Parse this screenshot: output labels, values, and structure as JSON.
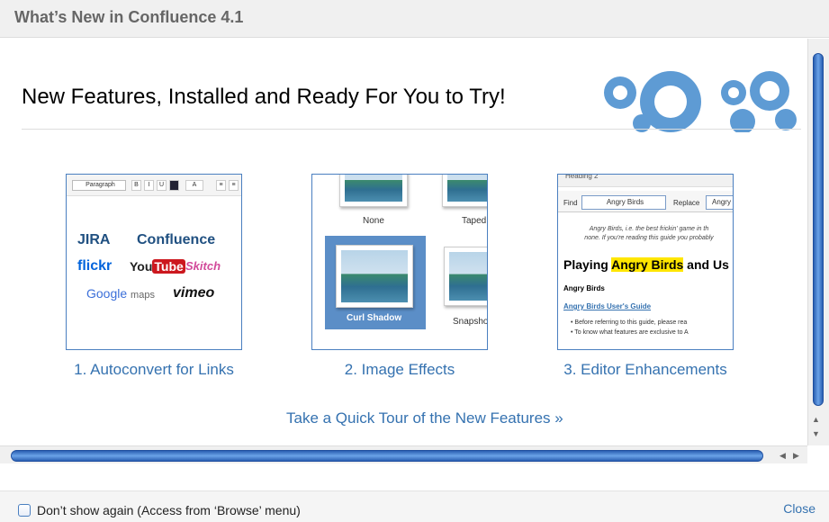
{
  "dialog": {
    "title": "What’s New in Confluence 4.1"
  },
  "content": {
    "headline": "New Features, Installed and Ready For You to Try!",
    "features": [
      {
        "caption": "1. Autoconvert for Links"
      },
      {
        "caption": "2. Image Effects"
      },
      {
        "caption": "3. Editor Enhancements"
      }
    ],
    "tour_link": "Take a Quick Tour of the New Features »"
  },
  "thumb1": {
    "paragraph": "Paragraph",
    "buttons": [
      "B",
      "I",
      "U",
      "A",
      "≡",
      "≡"
    ],
    "logos": {
      "jira": "JIRA",
      "confluence": "Confluence",
      "flickr": "flickr",
      "youtube_you": "You",
      "youtube_tube": "Tube",
      "skitch": "Skitch",
      "google": "Google",
      "maps": "maps",
      "vimeo": "vimeo"
    }
  },
  "thumb2": {
    "labels": {
      "none": "None",
      "taped": "Taped",
      "curl": "Curl Shadow",
      "snapshot": "Snapsho"
    }
  },
  "thumb3": {
    "toolbar_style": "Heading 2",
    "find_label": "Find",
    "find_value": "Angry Birds",
    "replace_label": "Replace",
    "replace_value": "Angry N",
    "para_line1": "Angry Birds, i.e. the best frickin' game in th",
    "para_line2": "none. If you're reading this guide you probably",
    "heading_pre": "Playing ",
    "heading_hl": "Angry Birds",
    "heading_post": " and Us",
    "subheading": "Angry Birds",
    "link": "Angry Birds User's Guide",
    "bullet1": "• Before referring to this guide, please rea",
    "bullet2": "• To know what features are exclusive to A"
  },
  "footer": {
    "checkbox_label": "Don’t show again (Access from ‘Browse’ menu)",
    "checkbox_checked": false,
    "close_label": "Close"
  },
  "colors": {
    "link": "#3572b0",
    "scroll": "#4a86d6",
    "gear": "#5e9bd4"
  }
}
